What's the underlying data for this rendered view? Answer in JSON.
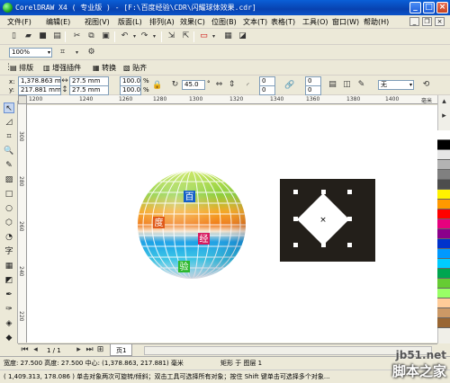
{
  "window": {
    "title": "CorelDRAW X4 ( 专业版 ) - [F:\\百度经验\\CDR\\闪耀球体效果.cdr]",
    "min": "_",
    "max": "□",
    "close": "×"
  },
  "menu": [
    "文件(F)",
    "编辑(E)",
    "视图(V)",
    "版面(L)",
    "排列(A)",
    "效果(C)",
    "位图(B)",
    "文本(T)",
    "表格(T)",
    "工具(O)",
    "窗口(W)",
    "帮助(H)"
  ],
  "zoom": {
    "value": "100%"
  },
  "plugin_bar": {
    "items": [
      "排版",
      "增强插件",
      "转换",
      "贴齐"
    ]
  },
  "props": {
    "x_label": "x:",
    "x": "1,378.863 mm",
    "y_label": "y:",
    "y": "217.881 mm",
    "w": "27.5 mm",
    "h": "27.5 mm",
    "sx": "100.0",
    "sy": "100.0",
    "pct": "%",
    "angle": "45.0",
    "deg": "°",
    "c1": "0",
    "c2": "0",
    "c3": "0",
    "c4": "0",
    "outline": "无"
  },
  "ruler": {
    "h_ticks": [
      "1200",
      "1240",
      "1260",
      "1280",
      "1300",
      "1320",
      "1340",
      "1360",
      "1380",
      "1400"
    ],
    "v_ticks": [
      "300",
      "280",
      "260",
      "240",
      "220"
    ],
    "unit": "毫米"
  },
  "sphere_labels": [
    "百",
    "度",
    "经",
    "验"
  ],
  "pagebar": {
    "counter": "1 / 1",
    "page_tab": "页1"
  },
  "status": {
    "line1": "宽度: 27.500  高度: 27.500  中心: (1,378.863, 217.881)  毫米",
    "object": "矩形 于 图层 1",
    "line2": "( 1,409.313, 178.086 )   单击对象两次可旋转/倾斜；双击工具可选择所有对象；按住 Shift 键单击可选择多个对象..."
  },
  "watermark": {
    "line1": "jb51.net",
    "line2": "脚本之家"
  },
  "palette": [
    "#ffffff",
    "#000000",
    "#e6e6e6",
    "#b3b3b3",
    "#808080",
    "#4d4d4d",
    "#fff200",
    "#ff9900",
    "#ff0000",
    "#e6007e",
    "#8b008b",
    "#0033cc",
    "#0099ff",
    "#00ccff",
    "#00a650",
    "#66cc33",
    "#99ff66",
    "#ffcc99",
    "#cc9966",
    "#996633"
  ]
}
